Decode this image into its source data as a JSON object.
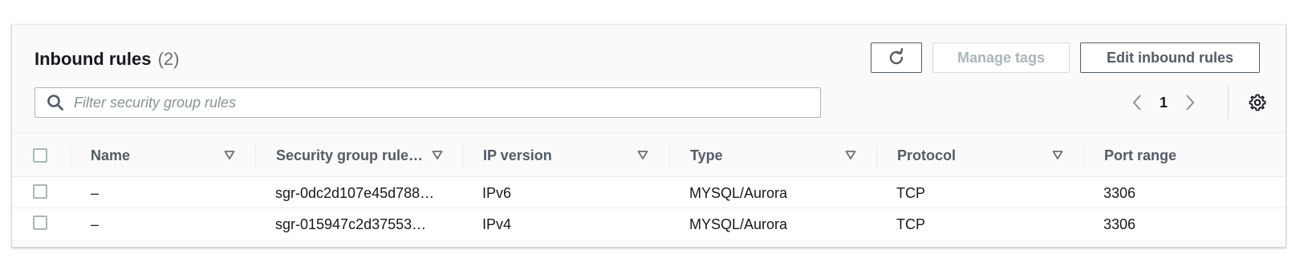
{
  "header": {
    "title": "Inbound rules",
    "count": "(2)"
  },
  "actions": {
    "refresh_icon": "refresh-icon",
    "manage_tags_label": "Manage tags",
    "edit_label": "Edit inbound rules"
  },
  "search": {
    "placeholder": "Filter security group rules",
    "value": ""
  },
  "pagination": {
    "current_page": "1"
  },
  "table": {
    "columns": [
      "Name",
      "Security group rule…",
      "IP version",
      "Type",
      "Protocol",
      "Port range"
    ],
    "rows": [
      {
        "name": "–",
        "rule_id": "sgr-0dc2d107e45d788…",
        "ip_version": "IPv6",
        "type": "MYSQL/Aurora",
        "protocol": "TCP",
        "port_range": "3306"
      },
      {
        "name": "–",
        "rule_id": "sgr-015947c2d37553…",
        "ip_version": "IPv4",
        "type": "MYSQL/Aurora",
        "protocol": "TCP",
        "port_range": "3306"
      }
    ]
  },
  "colors": {
    "border": "#d5dbdb",
    "text": "#16191f",
    "muted": "#545b64",
    "disabled": "#aab7b8"
  }
}
